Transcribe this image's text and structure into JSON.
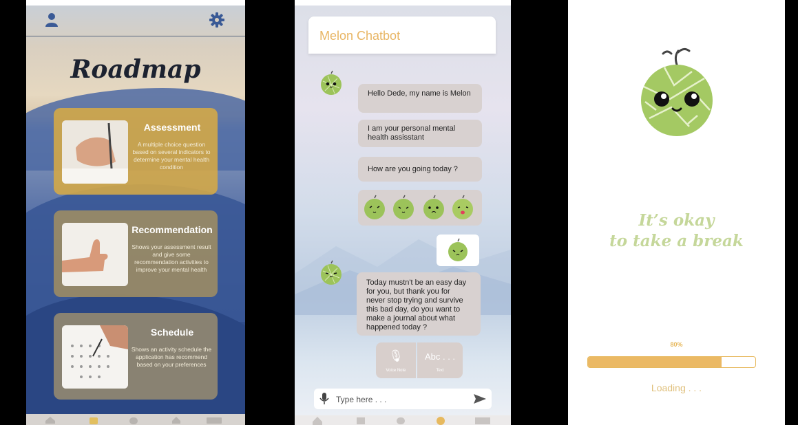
{
  "screen_roadmap": {
    "title": "Roadmap",
    "cards": [
      {
        "title": "Assessment",
        "description": "A multiple choice question based on several indicators to determine your mental health condition",
        "color": "#d2a84a"
      },
      {
        "title": "Recommendation",
        "description": "Shows your assessment result and give some recommendation activities to improve your mental health",
        "color": "#9a8a64"
      },
      {
        "title": "Schedule",
        "description": "Shows an activity schedule the application has recommend based on your preferences",
        "color": "#8f8570"
      }
    ],
    "icons": [
      "user-icon",
      "gear-icon"
    ]
  },
  "screen_chat": {
    "title": "Melon Chatbot",
    "messages": [
      "Hello Dede, my name is Melon",
      "I am your personal mental health assisstant",
      "How are you going today ?",
      "Today mustn't be an easy day for you, but thank you for never stop trying and survive this bad day, do you want to make a journal about what happened today ?"
    ],
    "quick_replies": [
      {
        "glyph": "🎙",
        "label": "Voice Note"
      },
      {
        "glyph": "Abc . . .",
        "label": "Text"
      }
    ],
    "input_placeholder": "Type here . . .",
    "accent": "#e8b563"
  },
  "screen_loading": {
    "message_line1": "It’s okay",
    "message_line2": "to take a break",
    "progress_label": "80%",
    "progress": 0.8,
    "loading_text": "Loading . . .",
    "accent": "#ebb964"
  }
}
